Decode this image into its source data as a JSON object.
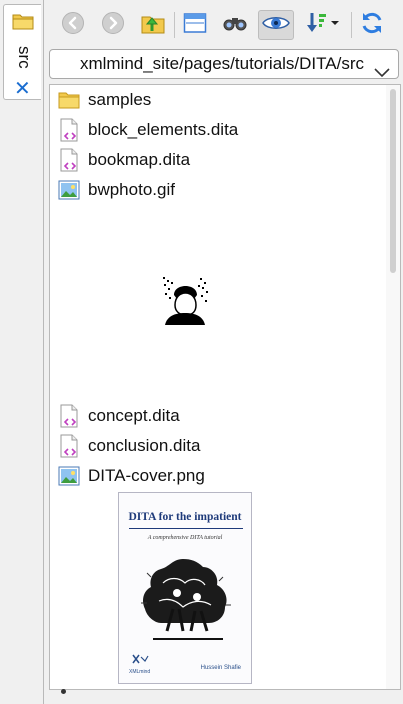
{
  "sidebar": {
    "tab_label": "src",
    "tab_icon": "folder-icon",
    "close_icon": "close-icon"
  },
  "toolbar": {
    "buttons": [
      {
        "name": "back",
        "icon": "back-arrow-icon"
      },
      {
        "name": "forward",
        "icon": "forward-arrow-icon"
      },
      {
        "name": "parent-folder",
        "icon": "folder-up-icon"
      },
      {
        "name": "view-mode",
        "icon": "window-icon"
      },
      {
        "name": "find",
        "icon": "binoculars-icon"
      },
      {
        "name": "preview",
        "icon": "eye-icon",
        "active": true
      },
      {
        "name": "sort",
        "icon": "sort-icon"
      },
      {
        "name": "refresh",
        "icon": "refresh-icon"
      }
    ]
  },
  "path": {
    "value": "xmlmind_site/pages/tutorials/DITA/src"
  },
  "files": [
    {
      "name": "samples",
      "type": "folder"
    },
    {
      "name": "block_elements.dita",
      "type": "dita"
    },
    {
      "name": "bookmap.dita",
      "type": "dita"
    },
    {
      "name": "bwphoto.gif",
      "type": "image"
    },
    {
      "name": "concept.dita",
      "type": "dita"
    },
    {
      "name": "conclusion.dita",
      "type": "dita"
    },
    {
      "name": "DITA-cover.png",
      "type": "image"
    }
  ],
  "cover": {
    "title": "DITA for the impatient",
    "subtitle": "A comprehensive DITA tutorial",
    "author": "Hussein Shafie",
    "publisher": "XMLmind"
  },
  "colors": {
    "accent": "#1a6dd0",
    "folder": "#f2c94c",
    "dita_badge": "#c040c0"
  }
}
